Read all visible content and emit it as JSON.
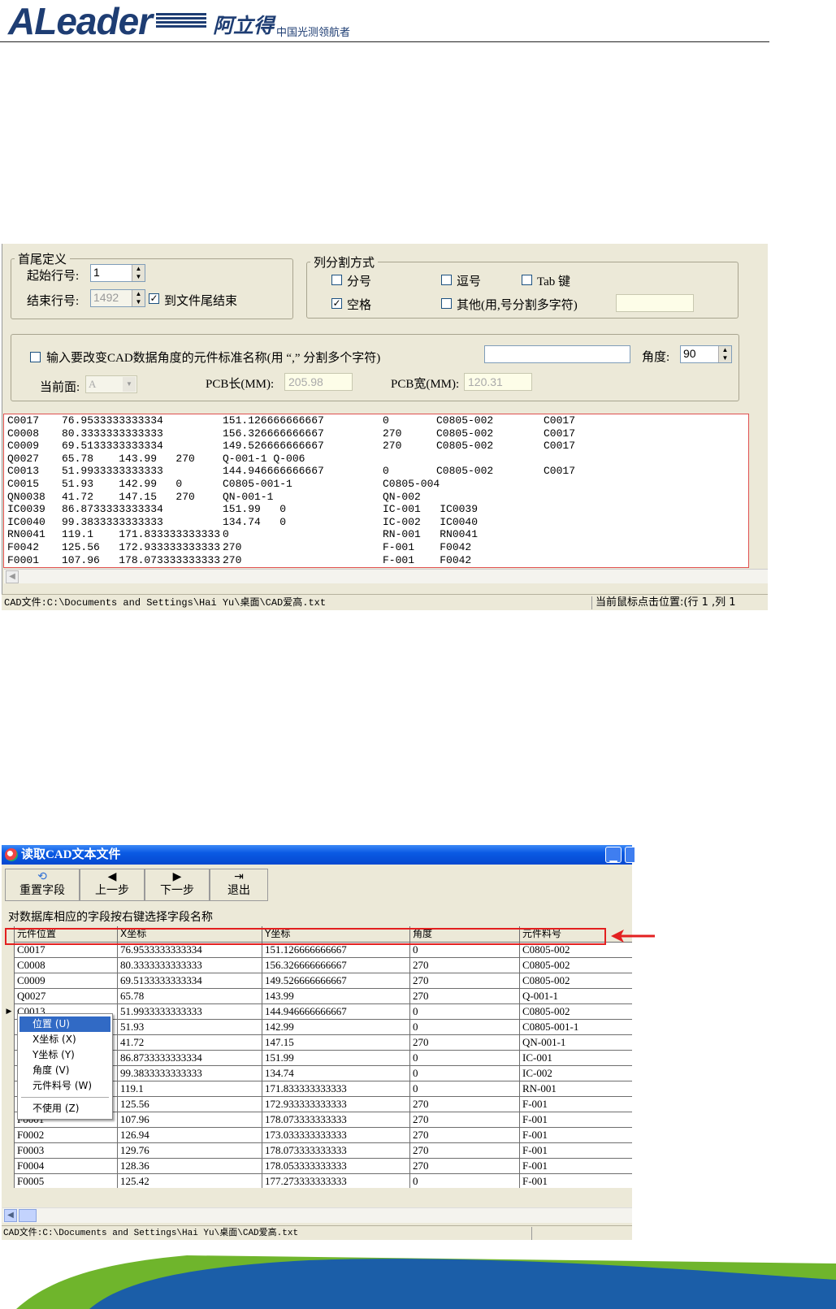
{
  "header": {
    "logo_text": "ALeader",
    "logo_cn": "阿立得",
    "slogan": "中国光测领航者"
  },
  "settings_panel": {
    "head_tail": {
      "legend": "首尾定义",
      "start_line_label": "起始行号:",
      "start_line_value": "1",
      "end_line_label": "结束行号:",
      "end_line_value": "1492",
      "to_end_checked": true,
      "to_end_label": "到文件尾结束"
    },
    "delimiter": {
      "legend": "列分割方式",
      "options": [
        {
          "label": "分号",
          "checked": false
        },
        {
          "label": "逗号",
          "checked": false
        },
        {
          "label": "Tab 键",
          "checked": false
        },
        {
          "label": "空格",
          "checked": true
        },
        {
          "label": "其他(用,号分割多字符)",
          "checked": false
        }
      ],
      "other_value": ""
    },
    "angle": {
      "checkbox_checked": false,
      "label": "输入要改变CAD数据角度的元件标准名称(用 “,” 分割多个字符)",
      "names_value": "",
      "angle_label": "角度:",
      "angle_value": "90",
      "side_label": "当前面:",
      "side_value": "A",
      "pcb_length_label": "PCB长(MM):",
      "pcb_length_value": "205.98",
      "pcb_width_label": "PCB宽(MM):",
      "pcb_width_value": "120.31"
    }
  },
  "cad_text": [
    [
      "C0017",
      "76.9533333333334",
      "151.126666666667",
      "0",
      "C0805-002",
      "C0017"
    ],
    [
      "C0008",
      "80.3333333333333",
      "156.326666666667",
      "270",
      "C0805-002",
      "C0017"
    ],
    [
      "C0009",
      "69.5133333333334",
      "149.526666666667",
      "270",
      "C0805-002",
      "C0017"
    ],
    [
      "Q0027",
      "65.78    143.99   270",
      "Q-001-1 Q-006",
      "",
      "",
      ""
    ],
    [
      "C0013",
      "51.9933333333333",
      "144.946666666667",
      "0",
      "C0805-002",
      "C0017"
    ],
    [
      "C0015",
      "51.93    142.99   0",
      "C0805-001-1",
      "C0805-004",
      "",
      ""
    ],
    [
      "QN0038",
      "41.72    147.15   270",
      "QN-001-1",
      "QN-002",
      "",
      ""
    ],
    [
      "IC0039",
      "86.8733333333334",
      "151.99   0",
      "IC-001   IC0039",
      "",
      ""
    ],
    [
      "IC0040",
      "99.3833333333333",
      "134.74   0",
      "IC-002   IC0040",
      "",
      ""
    ],
    [
      "RN0041",
      "119.1    171.833333333333",
      "0",
      "RN-001   RN0041",
      "",
      ""
    ],
    [
      "F0042",
      "125.56   172.933333333333",
      "270",
      "F-001    F0042",
      "",
      ""
    ],
    [
      "F0001",
      "107.96   178.073333333333",
      "270",
      "F-001    F0042",
      "",
      ""
    ]
  ],
  "status_bar_1": {
    "file_path": "CAD文件:C:\\Documents and Settings\\Hai Yu\\桌面\\CAD爱高.txt",
    "cursor_pos": "当前鼠标点击位置:(行 1 ,列 1"
  },
  "dialog": {
    "title": "读取CAD文本文件",
    "toolbar": [
      {
        "label": "重置字段",
        "icon": "reset-icon"
      },
      {
        "label": "上一步",
        "icon": "arrow-left-icon"
      },
      {
        "label": "下一步",
        "icon": "arrow-right-icon"
      },
      {
        "label": "退出",
        "icon": "exit-icon"
      }
    ],
    "hint": "对数据库相应的字段按右键选择字段名称",
    "columns": [
      "元件位置",
      "X坐标",
      "Y坐标",
      "角度",
      "元件料号"
    ],
    "rows": [
      [
        "C0017",
        "76.9533333333334",
        "151.126666666667",
        "0",
        "C0805-002"
      ],
      [
        "C0008",
        "80.3333333333333",
        "156.326666666667",
        "270",
        "C0805-002"
      ],
      [
        "C0009",
        "69.5133333333334",
        "149.526666666667",
        "270",
        "C0805-002"
      ],
      [
        "Q0027",
        "65.78",
        "143.99",
        "270",
        "Q-001-1"
      ],
      [
        "C0013",
        "51.9933333333333",
        "144.946666666667",
        "0",
        "C0805-002"
      ],
      [
        "",
        "51.93",
        "142.99",
        "0",
        "C0805-001-1"
      ],
      [
        "",
        "41.72",
        "147.15",
        "270",
        "QN-001-1"
      ],
      [
        "",
        "86.8733333333334",
        "151.99",
        "0",
        "IC-001"
      ],
      [
        "",
        "99.3833333333333",
        "134.74",
        "0",
        "IC-002"
      ],
      [
        "",
        "119.1",
        "171.833333333333",
        "0",
        "RN-001"
      ],
      [
        "",
        "125.56",
        "172.933333333333",
        "270",
        "F-001"
      ],
      [
        "F0001",
        "107.96",
        "178.073333333333",
        "270",
        "F-001"
      ],
      [
        "F0002",
        "126.94",
        "173.033333333333",
        "270",
        "F-001"
      ],
      [
        "F0003",
        "129.76",
        "178.073333333333",
        "270",
        "F-001"
      ],
      [
        "F0004",
        "128.36",
        "178.053333333333",
        "270",
        "F-001"
      ],
      [
        "F0005",
        "125.42",
        "177.273333333333",
        "0",
        "F-001"
      ]
    ],
    "context_menu": [
      {
        "label": "位置 (U)",
        "selected": true
      },
      {
        "label": "X坐标 (X)",
        "selected": false
      },
      {
        "label": "Y坐标 (Y)",
        "selected": false
      },
      {
        "label": "角度 (V)",
        "selected": false
      },
      {
        "label": "元件料号 (W)",
        "selected": false
      },
      {
        "label": "不使用 (Z)",
        "selected": false
      }
    ],
    "status_path": "CAD文件:C:\\Documents and Settings\\Hai Yu\\桌面\\CAD爱高.txt"
  },
  "colors": {
    "brand_blue": "#1e3d73",
    "highlight_red": "#e32020",
    "selection_blue": "#316ac5",
    "window_bg": "#ece9d8",
    "footer_green": "#6fb52c",
    "footer_blue": "#1b5ea8"
  }
}
